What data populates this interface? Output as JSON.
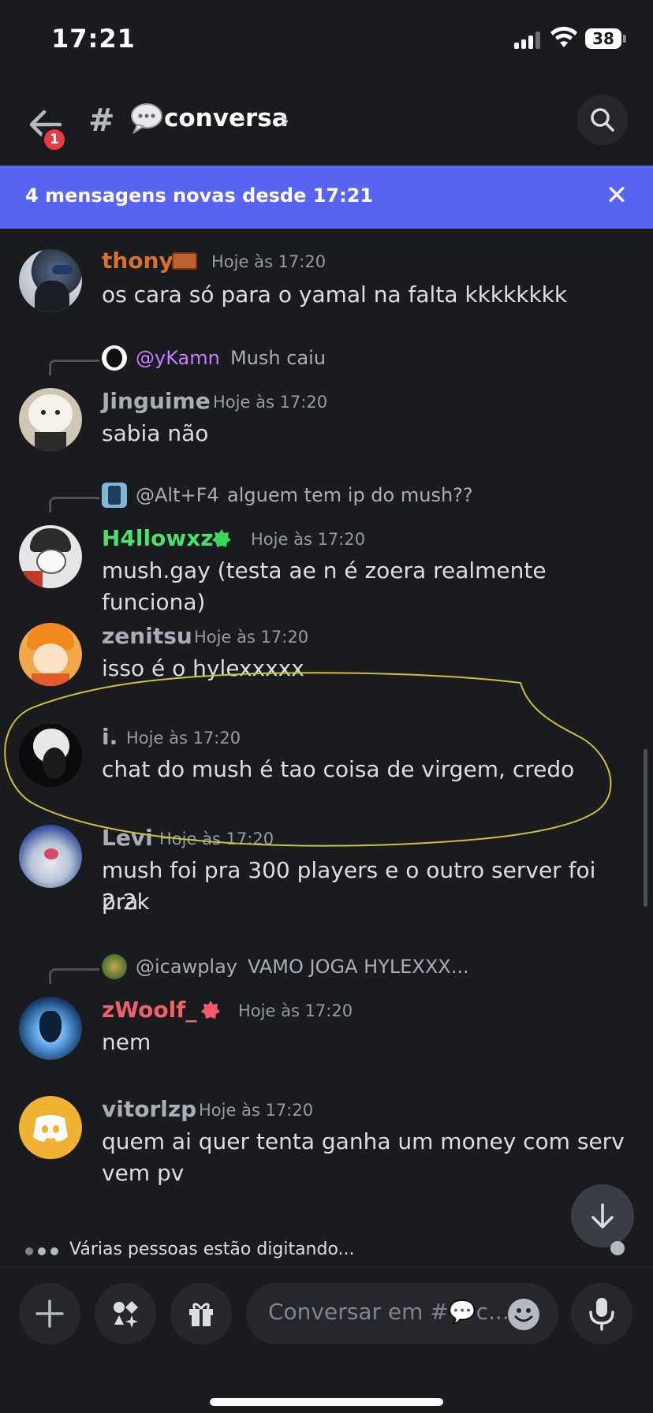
{
  "status_bar": {
    "time": "17:21",
    "battery": "38"
  },
  "header": {
    "channel_name": "conversa",
    "badge_count": "1",
    "channel_emoji": "speech-balloon-icon"
  },
  "new_messages_bar": {
    "text": "4 mensagens novas desde 17:21"
  },
  "messages": [
    {
      "author": "thony",
      "author_color": "#d9702c",
      "time": "Hoje às 17:20",
      "text": "os cara só para o yamal na falta kkkkkkkk"
    },
    {
      "reply_to": "@yKamn",
      "reply_color": "#c77dff",
      "reply_text": "Mush caiu",
      "author": "Jinguime",
      "author_color": "#a9aeb6",
      "time": "Hoje às 17:20",
      "text": "sabia não"
    },
    {
      "reply_to": "@Alt+F4",
      "reply_color": "#a9aeb6",
      "reply_text": "alguem tem ip do mush??",
      "author": "H4llowxz",
      "author_color": "#4cdf6a",
      "time": "Hoje às 17:20",
      "text": "mush.gay (testa ae n é zoera realmente funciona)"
    },
    {
      "author": "zenitsu",
      "author_color": "#a9aeb6",
      "time": "Hoje às 17:20",
      "text": "isso é o hylexxxxx"
    },
    {
      "author": "i.",
      "author_color": "#a9aeb6",
      "time": "Hoje às 17:20",
      "text": "chat do mush é tao coisa de virgem, credo"
    },
    {
      "author": "Levi",
      "author_color": "#a9aeb6",
      "time": "Hoje às 17:20",
      "text_line1": "mush foi pra 300 players e o outro server foi pra",
      "text_line2": "2.2k"
    },
    {
      "reply_to": "@icawplay",
      "reply_color": "#a9aeb6",
      "reply_text": "VAMO JOGA HYLEXXX...",
      "author": "zWoolf_",
      "author_color": "#f0626a",
      "time": "Hoje às 17:20",
      "text": "nem"
    },
    {
      "author": "vitorlzp",
      "author_color": "#a9aeb6",
      "time": "Hoje às 17:20",
      "text_line1": "quem ai quer tenta ganha um money com serv",
      "text_line2": "vem pv"
    }
  ],
  "typing": {
    "text": "Várias pessoas estão digitando..."
  },
  "composer": {
    "placeholder": "Conversar em #💬c..."
  },
  "colors": {
    "accent": "#5865f2",
    "background": "#1a1b1f",
    "badge": "#e63b44"
  }
}
